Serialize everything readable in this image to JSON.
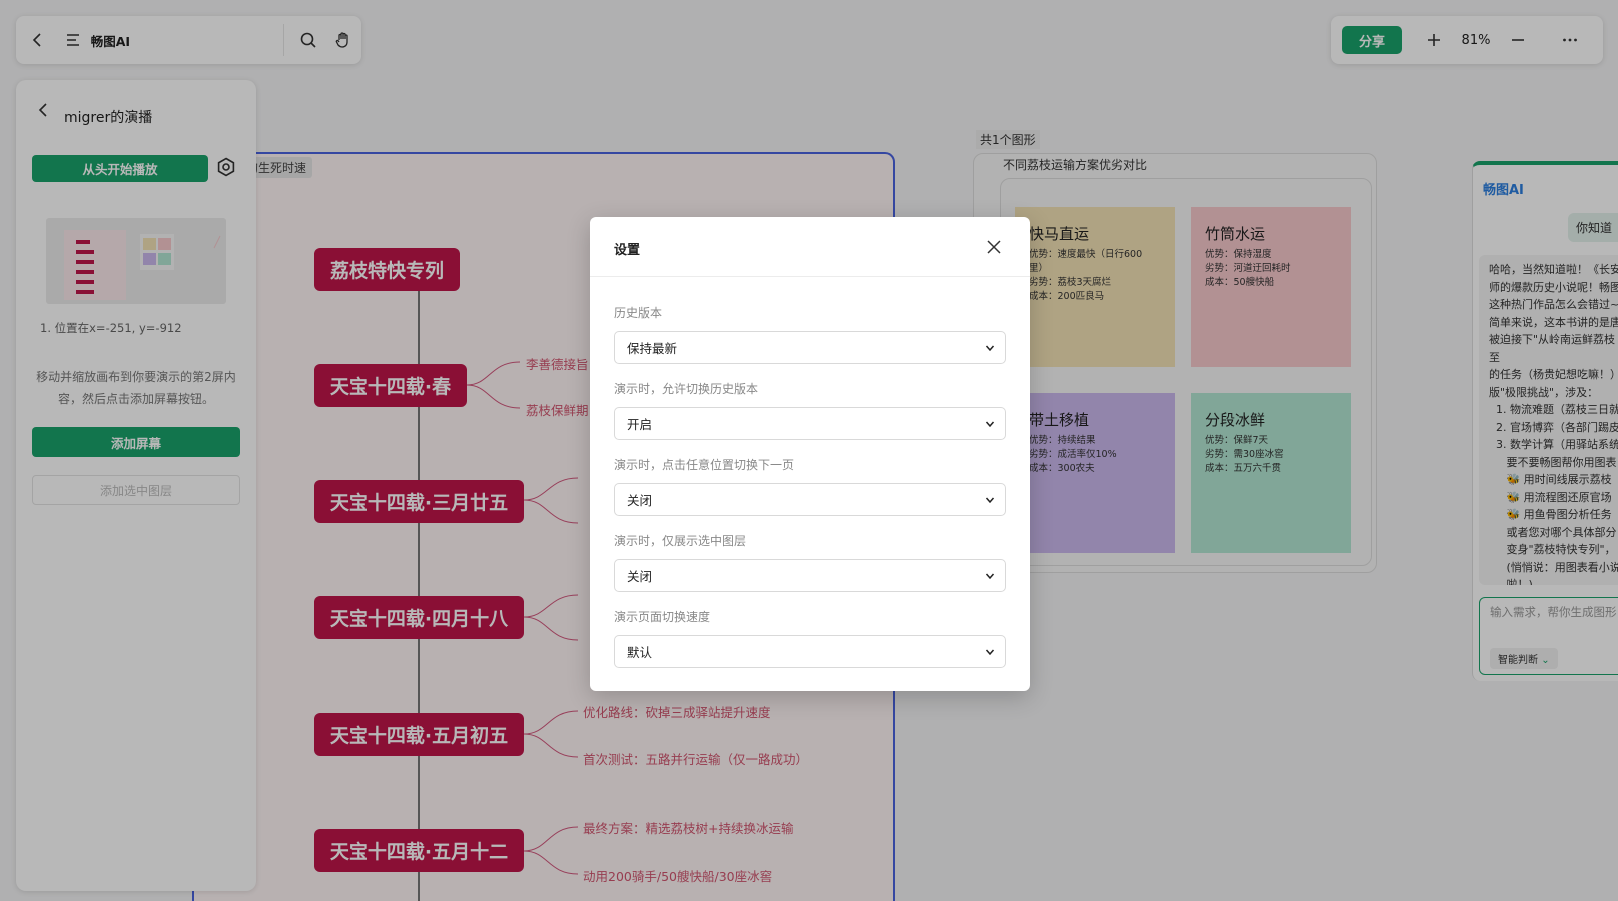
{
  "toolbar": {
    "doc_title": "畅图AI",
    "share_label": "分享",
    "zoom": "81%"
  },
  "presentation": {
    "title": "migrer的演播",
    "play_label": "从头开始播放",
    "screen_caption": "1. 位置在x=-251, y=-912",
    "hint": "移动并缩放画布到你要演示的第2屏内容，然后点击添加屏幕按钮。",
    "add_screen_label": "添加屏幕",
    "add_layer_label": "添加选中图层"
  },
  "canvas": {
    "frame_label": "的生死时速",
    "mindmap_nodes": [
      "荔枝特快专列",
      "天宝十四载·春",
      "天宝十四载·三月廿五",
      "天宝十四载·四月十八",
      "天宝十四载·五月初五",
      "天宝十四载·五月十二"
    ],
    "mindmap_leaves": [
      "李善德接旨",
      "荔枝保鲜期",
      "优化路线：砍掉三成驿站提升速度",
      "首次测试：五路并行运输（仅一路成功）",
      "最终方案：精选荔枝树+持续换冰运输",
      "动用200骑手/50艘快船/30座冰窖"
    ],
    "shape_count": "共1个图形",
    "compare_title": "不同荔枝运输方案优劣对比",
    "cards": [
      {
        "title": "快马直运",
        "lines": [
          "优势：速度最快（日行600",
          "里）",
          "劣势：荔枝3天腐烂",
          "成本：200匹良马"
        ],
        "color": "#f3e2b6"
      },
      {
        "title": "竹筒水运",
        "lines": [
          "优势：保持湿度",
          "劣势：河道迂回耗时",
          "成本：50艘快船"
        ],
        "color": "#f7c9cc"
      },
      {
        "title": "带土移植",
        "lines": [
          "优势：持续结果",
          "劣势：成活率仅10%",
          "成本：300农夫"
        ],
        "color": "#cbb9ee"
      },
      {
        "title": "分段冰鲜",
        "lines": [
          "优势：保鲜7天",
          "劣势：需30座冰窖",
          "成本：五万六千贯"
        ],
        "color": "#b3e7d3"
      }
    ]
  },
  "ai": {
    "title": "畅图AI",
    "question": "你知道《",
    "answer_lines": [
      "哈哈，当然知道啦！《长安",
      "师的爆款历史小说呢！畅图",
      "这种热门作品怎么会错过~",
      "简单来说，这本书讲的是唐",
      "被迫接下\"从岭南运鲜荔枝至",
      "的任务（杨贵妃想吃嘛！）",
      "版\"极限挑战\"，涉及：",
      "  1. 物流难题（荔枝三日就",
      "  2. 官场博弈（各部门踢皮",
      "  3. 数学计算（用驿站系统",
      "     要不要畅图帮你用图表",
      "     🐝 用时间线展示荔枝",
      "     🐝 用流程图还原官场",
      "     🐝 用鱼骨图分析任务",
      "     或者您对哪个具体部分",
      "     变身\"荔枝特快专列\"，",
      "     (悄悄说：用图表看小说",
      "     啦！)"
    ],
    "input_placeholder": "输入需求，帮你生成图形",
    "mode_label": "智能判断"
  },
  "modal": {
    "title": "设置",
    "fields": [
      {
        "label": "历史版本",
        "value": "保持最新"
      },
      {
        "label": "演示时，允许切换历史版本",
        "value": "开启"
      },
      {
        "label": "演示时，点击任意位置切换下一页",
        "value": "关闭"
      },
      {
        "label": "演示时，仅展示选中图层",
        "value": "关闭"
      },
      {
        "label": "演示页面切换速度",
        "value": "默认"
      }
    ]
  },
  "colors": {
    "accent_green": "#1aa36b",
    "node_red": "#c0154a",
    "frame_blue": "#4a63e0"
  }
}
